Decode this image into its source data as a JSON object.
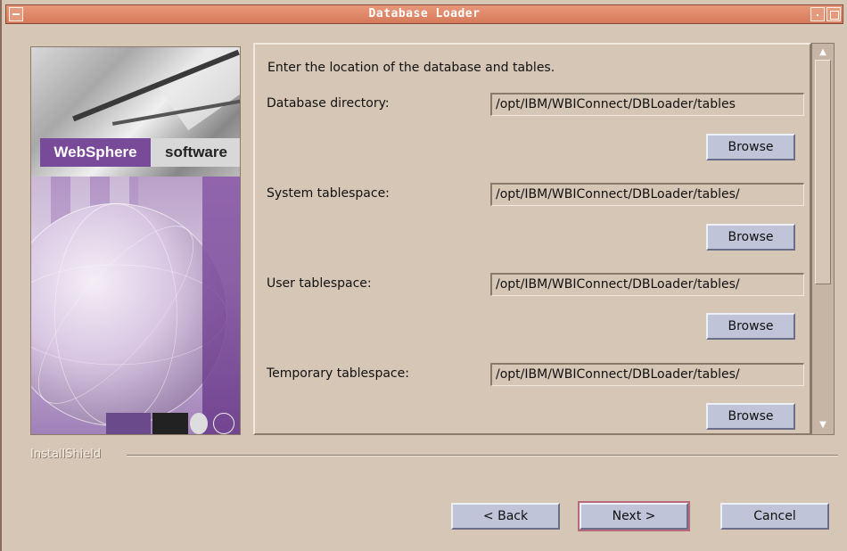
{
  "window": {
    "title": "Database Loader"
  },
  "branding": {
    "websphere": "WebSphere",
    "software": "software"
  },
  "content": {
    "instruction": "Enter the location of the database and tables.",
    "fields": [
      {
        "label": "Database directory:",
        "value": "/opt/IBM/WBIConnect/DBLoader/tables",
        "browse": "Browse"
      },
      {
        "label": "System tablespace:",
        "value": "/opt/IBM/WBIConnect/DBLoader/tables/",
        "browse": "Browse"
      },
      {
        "label": "User tablespace:",
        "value": "/opt/IBM/WBIConnect/DBLoader/tables/",
        "browse": "Browse"
      },
      {
        "label": "Temporary tablespace:",
        "value": "/opt/IBM/WBIConnect/DBLoader/tables/",
        "browse": "Browse"
      }
    ]
  },
  "footer": {
    "installshield": "InstallShield",
    "back": "< Back",
    "next": "Next >",
    "cancel": "Cancel"
  },
  "colors": {
    "titlebar": "#d67a5a",
    "background": "#d6c6b6",
    "button": "#c0c4d8",
    "brand_purple": "#7a4a9a"
  }
}
